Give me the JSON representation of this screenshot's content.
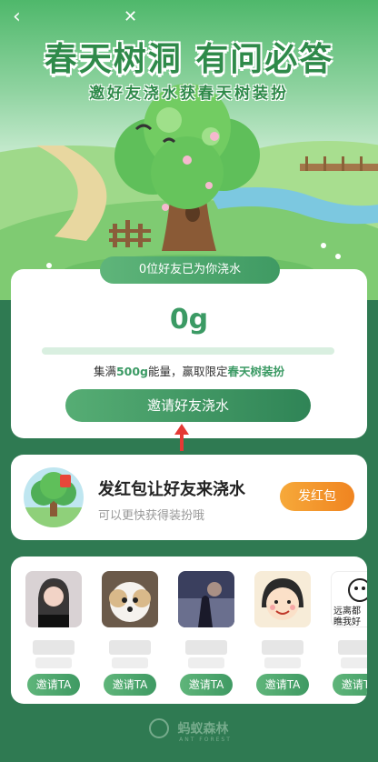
{
  "hero": {
    "title": "春天树洞 有问必答",
    "subtitle": "邀好友浇水获春天树装扮"
  },
  "watering": {
    "friends_watered": "0位好友已为你浇水",
    "grams": "0g",
    "progress_fraction": 0,
    "note_prefix": "集满",
    "note_amount": "500g",
    "note_middle": "能量，赢取限定",
    "note_reward": "春天树装扮",
    "invite_button": "邀请好友浇水"
  },
  "redpack": {
    "title": "发红包让好友来浇水",
    "subtitle": "可以更快获得装扮哦",
    "button": "发红包"
  },
  "friends": {
    "invite_label": "邀请TA",
    "items": [
      {
        "photo": "girl-portrait"
      },
      {
        "photo": "dog-portrait"
      },
      {
        "photo": "dusk-figure"
      },
      {
        "photo": "cartoon-girl"
      },
      {
        "photo": "meme-face",
        "caption_1": "远离都 ",
        "caption_2": "瞧我好 "
      }
    ]
  },
  "footer": {
    "brand": "蚂蚁森林",
    "brand_en": "ANT FOREST"
  },
  "colors": {
    "accent_green": "#3b9a64",
    "background": "#2f7a52",
    "orange": "#f08420"
  }
}
